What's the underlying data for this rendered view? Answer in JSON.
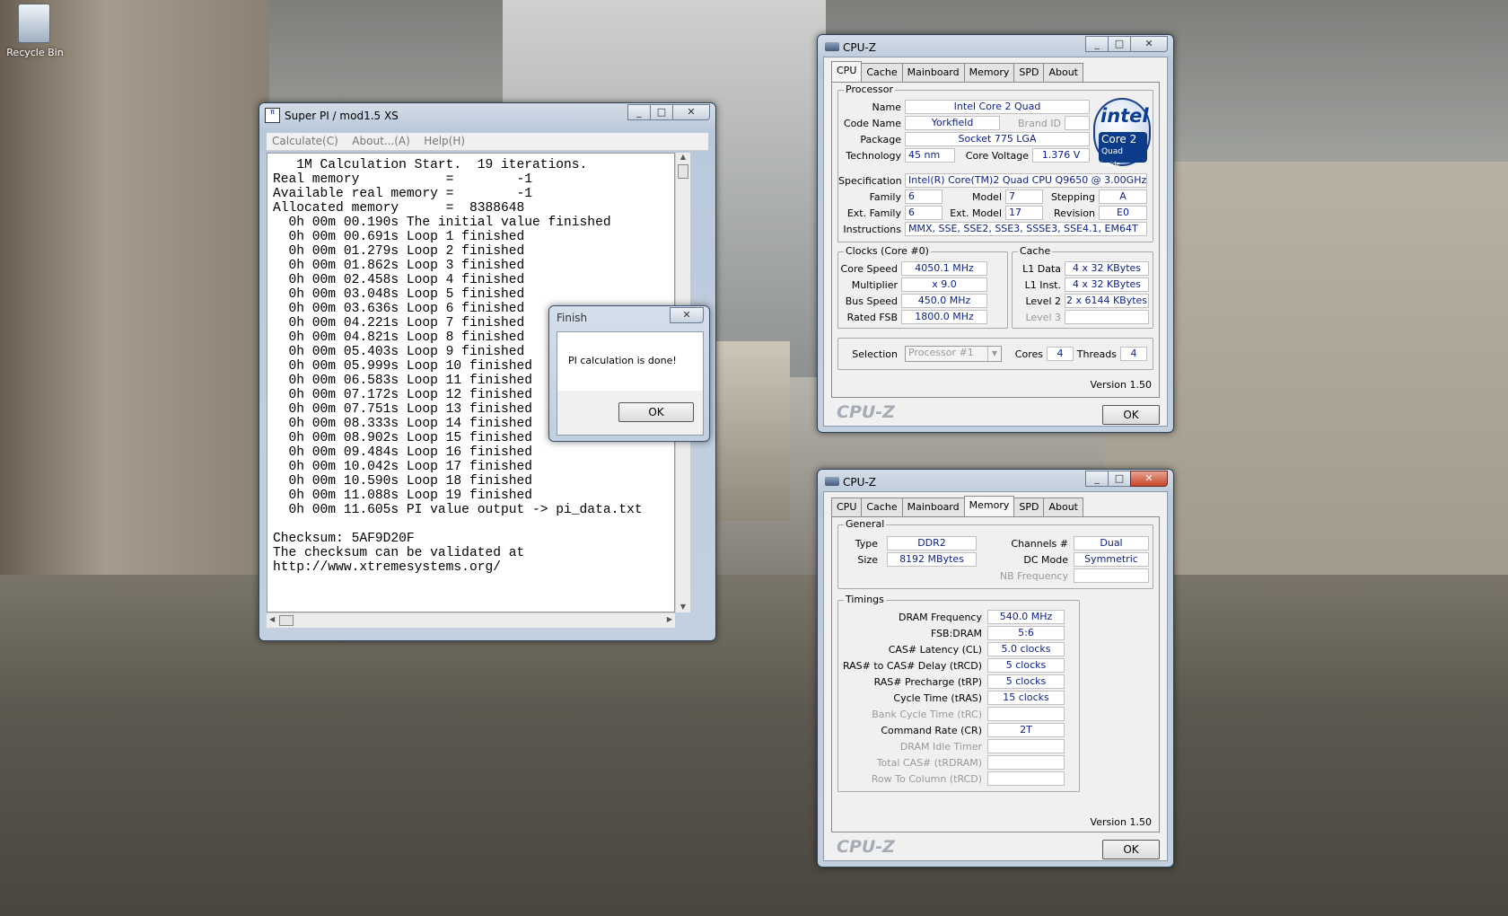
{
  "desktop": {
    "recycle_label": "Recycle Bin"
  },
  "superpi": {
    "title": "Super PI / mod1.5 XS",
    "menu": [
      "Calculate(C)",
      "About...(A)",
      "Help(H)"
    ],
    "output": [
      "   1M Calculation Start.  19 iterations.",
      "Real memory           =        -1",
      "Available real memory =        -1",
      "Allocated memory      =  8388648",
      "  0h 00m 00.190s The initial value finished",
      "  0h 00m 00.691s Loop 1 finished",
      "  0h 00m 01.279s Loop 2 finished",
      "  0h 00m 01.862s Loop 3 finished",
      "  0h 00m 02.458s Loop 4 finished",
      "  0h 00m 03.048s Loop 5 finished",
      "  0h 00m 03.636s Loop 6 finished",
      "  0h 00m 04.221s Loop 7 finished",
      "  0h 00m 04.821s Loop 8 finished",
      "  0h 00m 05.403s Loop 9 finished",
      "  0h 00m 05.999s Loop 10 finished",
      "  0h 00m 06.583s Loop 11 finished",
      "  0h 00m 07.172s Loop 12 finished",
      "  0h 00m 07.751s Loop 13 finished",
      "  0h 00m 08.333s Loop 14 finished",
      "  0h 00m 08.902s Loop 15 finished",
      "  0h 00m 09.484s Loop 16 finished",
      "  0h 00m 10.042s Loop 17 finished",
      "  0h 00m 10.590s Loop 18 finished",
      "  0h 00m 11.088s Loop 19 finished",
      "  0h 00m 11.605s PI value output -> pi_data.txt",
      "",
      "Checksum: 5AF9D20F",
      "The checksum can be validated at",
      "http://www.xtremesystems.org/"
    ]
  },
  "finish": {
    "title": "Finish",
    "message": "PI calculation is done!",
    "ok": "OK"
  },
  "cpuz1": {
    "title": "CPU-Z",
    "tabs": [
      "CPU",
      "Cache",
      "Mainboard",
      "Memory",
      "SPD",
      "About"
    ],
    "processor": {
      "group": "Processor",
      "name_l": "Name",
      "name": "Intel Core 2 Quad",
      "code_l": "Code Name",
      "code": "Yorkfield",
      "brand_l": "Brand ID",
      "package_l": "Package",
      "package": "Socket 775 LGA",
      "tech_l": "Technology",
      "tech": "45 nm",
      "cv_l": "Core Voltage",
      "cv": "1.376 V",
      "spec_l": "Specification",
      "spec": "Intel(R) Core(TM)2 Quad CPU    Q9650  @ 3.00GHz",
      "fam_l": "Family",
      "fam": "6",
      "model_l": "Model",
      "model": "7",
      "step_l": "Stepping",
      "step": "A",
      "efam_l": "Ext. Family",
      "efam": "6",
      "emodel_l": "Ext. Model",
      "emodel": "17",
      "rev_l": "Revision",
      "rev": "E0",
      "instr_l": "Instructions",
      "instr": "MMX, SSE, SSE2, SSE3, SSSE3, SSE4.1, EM64T"
    },
    "intel": {
      "brand": "intel",
      "line1": "Core 2",
      "line2": "Quad",
      "line3": "inside"
    },
    "clocks": {
      "group": "Clocks (Core #0)",
      "cs_l": "Core Speed",
      "cs": "4050.1 MHz",
      "mul_l": "Multiplier",
      "mul": "x 9.0",
      "bus_l": "Bus Speed",
      "bus": "450.0 MHz",
      "fsb_l": "Rated FSB",
      "fsb": "1800.0 MHz"
    },
    "cache": {
      "group": "Cache",
      "l1d_l": "L1 Data",
      "l1d": "4 x 32 KBytes",
      "l1i_l": "L1 Inst.",
      "l1i": "4 x 32 KBytes",
      "l2_l": "Level 2",
      "l2": "2 x 6144 KBytes",
      "l3_l": "Level 3"
    },
    "sel": {
      "sel_l": "Selection",
      "sel": "Processor #1",
      "cores_l": "Cores",
      "cores": "4",
      "threads_l": "Threads",
      "threads": "4"
    },
    "version": "Version 1.50",
    "logo": "CPU-Z",
    "ok": "OK"
  },
  "cpuz2": {
    "title": "CPU-Z",
    "tabs": [
      "CPU",
      "Cache",
      "Mainboard",
      "Memory",
      "SPD",
      "About"
    ],
    "general": {
      "group": "General",
      "type_l": "Type",
      "type": "DDR2",
      "size_l": "Size",
      "size": "8192 MBytes",
      "ch_l": "Channels #",
      "ch": "Dual",
      "dc_l": "DC Mode",
      "dc": "Symmetric",
      "nb_l": "NB Frequency"
    },
    "timings": {
      "group": "Timings",
      "rows": [
        {
          "label": "DRAM Frequency",
          "value": "540.0 MHz",
          "dim": false
        },
        {
          "label": "FSB:DRAM",
          "value": "5:6",
          "dim": false
        },
        {
          "label": "CAS# Latency (CL)",
          "value": "5.0 clocks",
          "dim": false
        },
        {
          "label": "RAS# to CAS# Delay (tRCD)",
          "value": "5 clocks",
          "dim": false
        },
        {
          "label": "RAS# Precharge (tRP)",
          "value": "5 clocks",
          "dim": false
        },
        {
          "label": "Cycle Time (tRAS)",
          "value": "15 clocks",
          "dim": false
        },
        {
          "label": "Bank Cycle Time (tRC)",
          "value": "",
          "dim": true
        },
        {
          "label": "Command Rate (CR)",
          "value": "2T",
          "dim": false
        },
        {
          "label": "DRAM Idle Timer",
          "value": "",
          "dim": true
        },
        {
          "label": "Total CAS# (tRDRAM)",
          "value": "",
          "dim": true
        },
        {
          "label": "Row To Column (tRCD)",
          "value": "",
          "dim": true
        }
      ]
    },
    "version": "Version 1.50",
    "logo": "CPU-Z",
    "ok": "OK"
  }
}
